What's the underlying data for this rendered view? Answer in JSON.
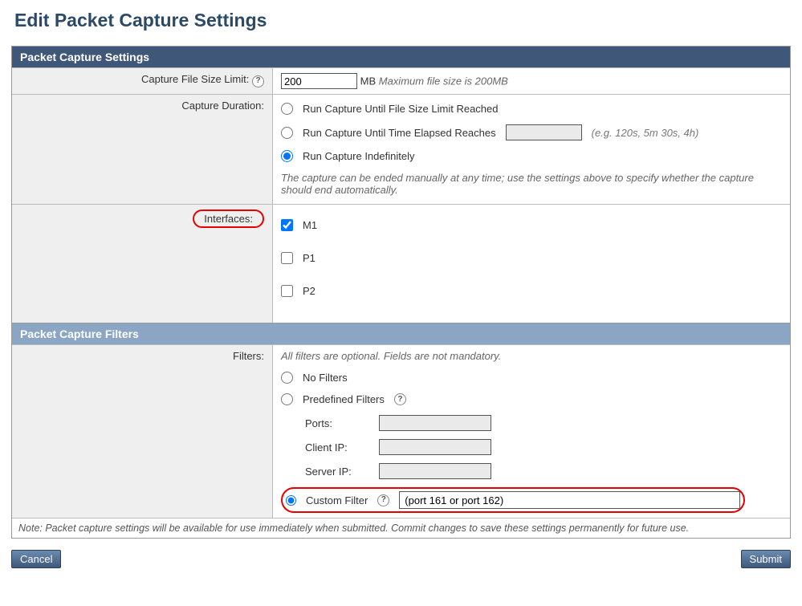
{
  "page_title": "Edit Packet Capture Settings",
  "section1_header": "Packet Capture Settings",
  "subsection_header": "Packet Capture Filters",
  "file_size": {
    "label": "Capture File Size Limit:",
    "value": "200",
    "unit": "MB",
    "hint": "Maximum file size is 200MB"
  },
  "duration": {
    "label": "Capture Duration:",
    "opt_until_size": "Run Capture Until File Size Limit Reached",
    "opt_until_time": "Run Capture Until Time Elapsed Reaches",
    "time_hint": "(e.g. 120s, 5m 30s, 4h)",
    "opt_indef": "Run Capture Indefinitely",
    "note": "The capture can be ended manually at any time; use the settings above to specify whether the capture should end automatically."
  },
  "interfaces": {
    "label": "Interfaces:",
    "m1": "M1",
    "p1": "P1",
    "p2": "P2"
  },
  "filters": {
    "label": "Filters:",
    "hint_top": "All filters are optional. Fields are not mandatory.",
    "opt_none": "No Filters",
    "opt_predef": "Predefined Filters",
    "ports_label": "Ports:",
    "clientip_label": "Client IP:",
    "serverip_label": "Server IP:",
    "opt_custom": "Custom Filter",
    "custom_value": "(port 161 or port 162)"
  },
  "footer_note": "Note: Packet capture settings will be available for use immediately when submitted. Commit changes to save these settings permanently for future use.",
  "buttons": {
    "cancel": "Cancel",
    "submit": "Submit"
  }
}
